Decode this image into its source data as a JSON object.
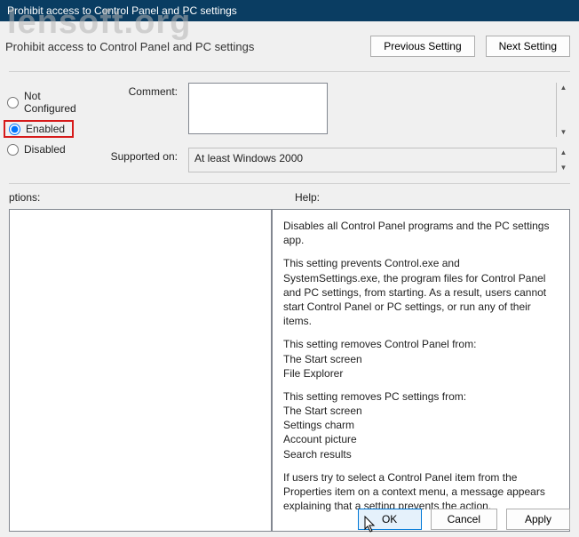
{
  "window": {
    "title": "Prohibit access to Control Panel and PC settings"
  },
  "watermark": "lensoft.org",
  "header": {
    "policy_title": "Prohibit access to Control Panel and PC settings",
    "prev": "Previous Setting",
    "next": "Next Setting"
  },
  "radios": {
    "not_configured": "Not Configured",
    "enabled": "Enabled",
    "disabled": "Disabled"
  },
  "fields": {
    "comment_label": "Comment:",
    "comment_value": "",
    "supported_label": "Supported on:",
    "supported_value": "At least Windows 2000"
  },
  "labels": {
    "options": "ptions:",
    "help": "Help:"
  },
  "help_text": {
    "p1": "Disables all Control Panel programs and the PC settings app.",
    "p2": "This setting prevents Control.exe and SystemSettings.exe, the program files for Control Panel and PC settings, from starting. As a result, users cannot start Control Panel or PC settings, or run any of their items.",
    "p3": "This setting removes Control Panel from:",
    "p3a": "The Start screen",
    "p3b": "File Explorer",
    "p4": "This setting removes PC settings from:",
    "p4a": "The Start screen",
    "p4b": "Settings charm",
    "p4c": "Account picture",
    "p4d": "Search results",
    "p5": "If users try to select a Control Panel item from the Properties item on a context menu, a message appears explaining that a setting prevents the action."
  },
  "footer": {
    "ok": "OK",
    "cancel": "Cancel",
    "apply": "Apply"
  }
}
